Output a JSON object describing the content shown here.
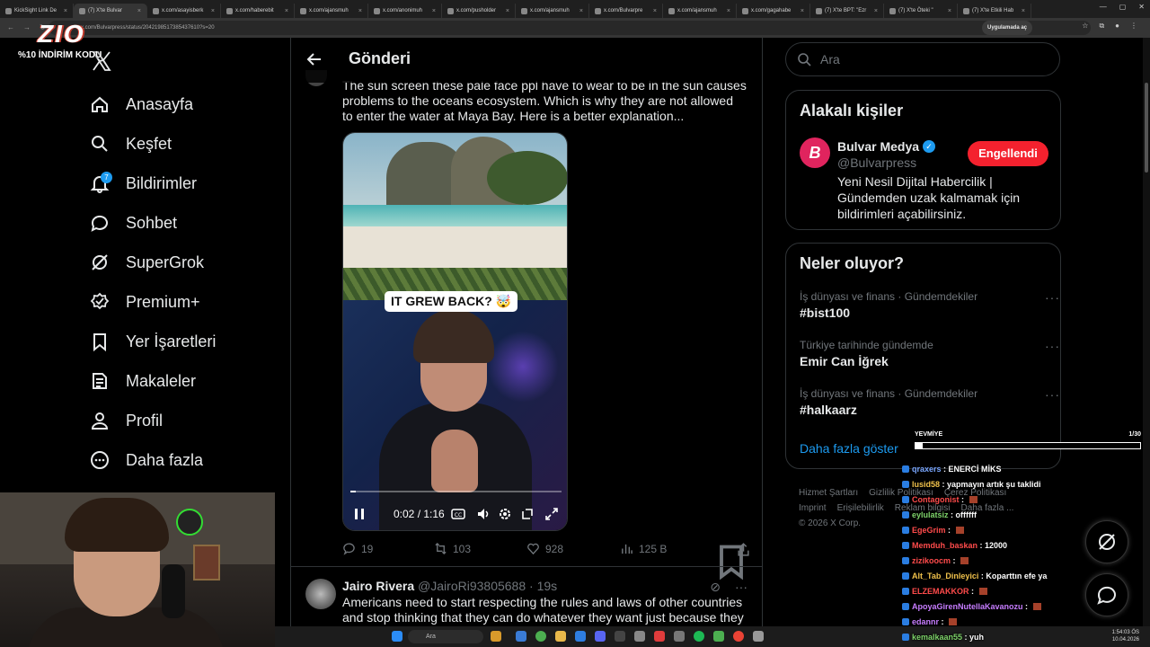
{
  "browser": {
    "tabs": [
      "KickSight Link De",
      "(7) X'te Bulvar",
      "x.com/asayisberk",
      "x.com/haberebit",
      "x.com/ajansmuh",
      "x.com/anonimuh",
      "x.com/pusholder",
      "x.com/ajansmuh",
      "x.com/Bulvarpre",
      "x.com/ajansmuh",
      "x.com/gagahabe",
      "(7) X'te BPT: \"Ezr",
      "(7) X'te Öteki \"",
      "(7) X'te Etkili Hab"
    ],
    "address": "x.com/Bulvarpress/status/2042198517385437610?s=20",
    "app_button": "Uygulamada aç"
  },
  "promo": {
    "logo": "ZIO",
    "discount": "%10 İNDİRİM KODU"
  },
  "nav": {
    "items": [
      {
        "label": "Anasayfa",
        "icon": "home-icon"
      },
      {
        "label": "Keşfet",
        "icon": "search-icon"
      },
      {
        "label": "Bildirimler",
        "icon": "bell-icon",
        "badge": "7"
      },
      {
        "label": "Sohbet",
        "icon": "chat-icon"
      },
      {
        "label": "SuperGrok",
        "icon": "grok-icon"
      },
      {
        "label": "Premium+",
        "icon": "premium-icon"
      },
      {
        "label": "Yer İşaretleri",
        "icon": "bookmark-icon"
      },
      {
        "label": "Makaleler",
        "icon": "article-icon"
      },
      {
        "label": "Profil",
        "icon": "profile-icon"
      },
      {
        "label": "Daha fazla",
        "icon": "more-icon"
      }
    ]
  },
  "post": {
    "header_title": "Gönderi",
    "text": "The sun screen these pale face ppl have to wear to be in the sun causes problems to the oceans ecosystem. Which is why they are not allowed to enter the water at Maya Bay. Here is a better explanation...",
    "video": {
      "caption": "IT GREW BACK? 🤯",
      "time": "0:02 / 1:16",
      "progress": 0.026
    },
    "stats": {
      "replies": "19",
      "reposts": "103",
      "likes": "928",
      "views": "125 B"
    }
  },
  "reply": {
    "name": "Jairo Rivera",
    "handle": "@JairoRi93805688 · 19s",
    "text": "Americans need to start respecting the rules and laws of other countries and stop thinking that they can do whatever they want just because they"
  },
  "sidebar": {
    "search_placeholder": "Ara",
    "related": {
      "title": "Alakalı kişiler",
      "name": "Bulvar Medya",
      "handle": "@Bulvarpress",
      "button": "Engellendi",
      "bio": "Yeni Nesil Dijital Habercilik | Gündemden uzak kalmamak için bildirimleri açabilirsiniz.",
      "colors": {
        "brand": "#e0245e",
        "button": "#f4212e"
      }
    },
    "trends": {
      "title": "Neler oluyor?",
      "items": [
        {
          "meta": "İş dünyası ve finans · Gündemdekiler",
          "name": "#bist100"
        },
        {
          "meta": "Türkiye tarihinde gündemde",
          "name": "Emir Can İğrek"
        },
        {
          "meta": "İş dünyası ve finans · Gündemdekiler",
          "name": "#halkaarz"
        }
      ],
      "show_more": "Daha fazla göster"
    },
    "footer": [
      "Hizmet Şartları",
      "Gizlilik Politikası",
      "Çerez Politikası",
      "Imprint",
      "Erişilebilirlik",
      "Reklam bilgisi",
      "Daha fazla ...",
      "© 2026 X Corp."
    ]
  },
  "overlay": {
    "yevmiye_label": "YEVMİYE",
    "yevmiye_count": "1/30",
    "yevmiye_progress": 0.033,
    "chat": [
      {
        "user": "qraxers",
        "color": "#7aa7ff",
        "msg": "ENERCİ MİKS"
      },
      {
        "user": "lusid58",
        "color": "#f0c14b",
        "msg": "yapmayın artık şu taklidi"
      },
      {
        "user": "Contagonist",
        "color": "#ff4b4b",
        "msg": ""
      },
      {
        "user": "eylulatsiz",
        "color": "#7fd46b",
        "msg": "offffff"
      },
      {
        "user": "EgeGrim",
        "color": "#ff4b4b",
        "msg": ""
      },
      {
        "user": "Memduh_baskan",
        "color": "#ff4b4b",
        "msg": "12000"
      },
      {
        "user": "zizikoocm",
        "color": "#ff4b4b",
        "msg": ""
      },
      {
        "user": "Alt_Tab_Dinleyici",
        "color": "#f0c14b",
        "msg": "Koparttın efe ya"
      },
      {
        "user": "ELZEMAKKOR",
        "color": "#ff4b4b",
        "msg": ""
      },
      {
        "user": "ApoyaGirenNutellaKavanozu",
        "color": "#c77dff",
        "msg": ""
      },
      {
        "user": "edannr",
        "color": "#c77dff",
        "msg": ""
      },
      {
        "user": "kemalkaan55",
        "color": "#7fd46b",
        "msg": "yuh"
      }
    ]
  },
  "taskbar": {
    "search": "Ara",
    "time": "1:54:03 ÖS",
    "date": "10.04.2026"
  }
}
